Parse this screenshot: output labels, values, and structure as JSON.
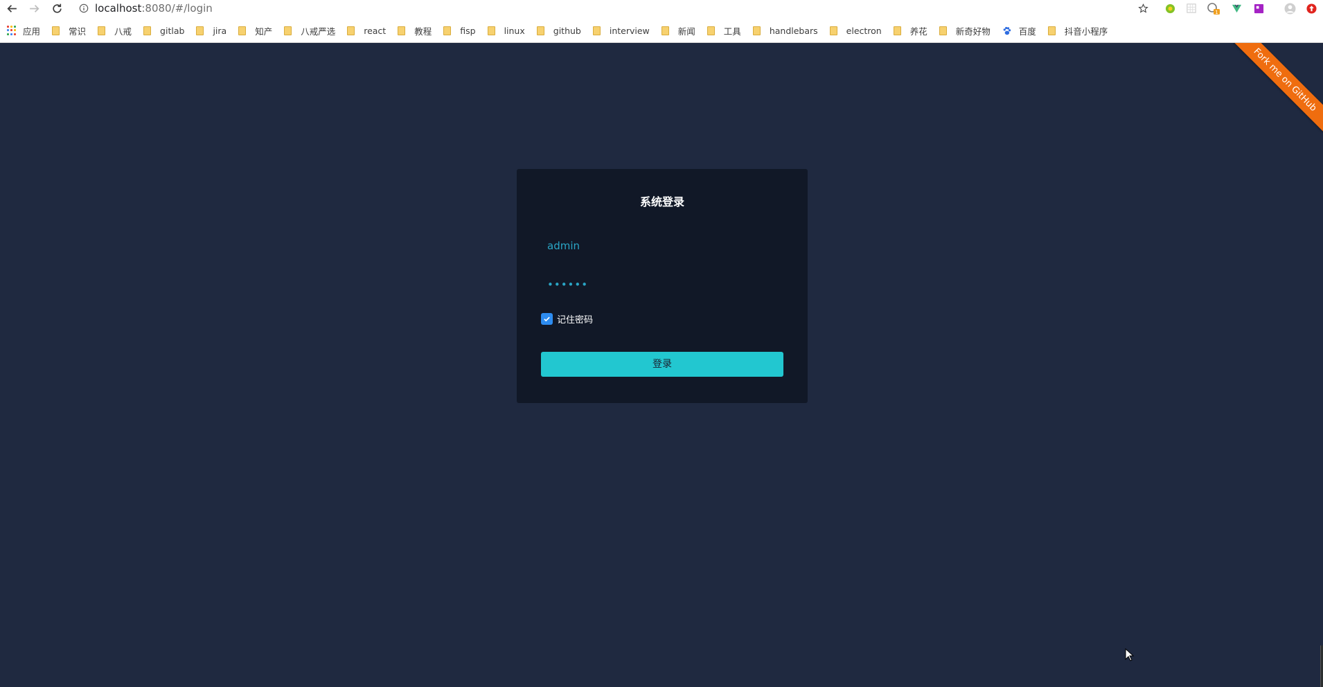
{
  "browser": {
    "url_host": "localhost",
    "url_path": ":8080/#/login",
    "apps_label": "应用",
    "bookmarks": [
      "常识",
      "八戒",
      "gitlab",
      "jira",
      "知产",
      "八戒严选",
      "react",
      "教程",
      "fisp",
      "linux",
      "github",
      "interview",
      "新闻",
      "工具",
      "handlebars",
      "electron",
      "养花"
    ],
    "bookmarks_tail": [
      "新奇好物"
    ],
    "baidu_label": "百度",
    "last_bookmark": "抖音小程序",
    "extension_badge": "1"
  },
  "ribbon": {
    "text": "Fork me on GitHub"
  },
  "login": {
    "title": "系统登录",
    "username": "admin",
    "password": "••••••",
    "remember_label": "记住密码",
    "remember_checked": true,
    "submit_label": "登录"
  },
  "colors": {
    "page_bg": "#1f2940",
    "card_bg": "#111827",
    "accent": "#22c7d0",
    "input_text": "#2aa6c6",
    "checkbox": "#2d8cf0",
    "ribbon": "#ef6d0f"
  }
}
